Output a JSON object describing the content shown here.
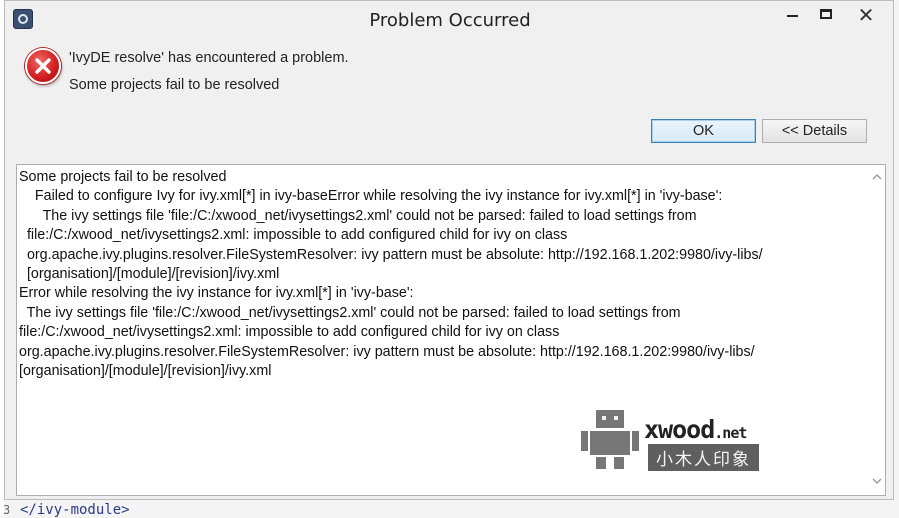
{
  "background": {
    "line_number": "3",
    "code_line": "</ivy-module>"
  },
  "window": {
    "title": "Problem Occurred",
    "minimize_label": "–",
    "maximize_label": "□",
    "close_label": "✕"
  },
  "message": {
    "line1": "'IvyDE resolve' has encountered a problem.",
    "line2": "Some projects fail to be resolved"
  },
  "buttons": {
    "ok": "OK",
    "details": "<< Details"
  },
  "details": {
    "lines": [
      "Some projects fail to be resolved",
      "    Failed to configure Ivy for ivy.xml[*] in ivy-baseError while resolving the ivy instance for ivy.xml[*] in 'ivy-base':",
      "      The ivy settings file 'file:/C:/xwood_net/ivysettings2.xml' could not be parsed: failed to load settings from",
      "  file:/C:/xwood_net/ivysettings2.xml: impossible to add configured child for ivy on class",
      "  org.apache.ivy.plugins.resolver.FileSystemResolver: ivy pattern must be absolute: http://192.168.1.202:9980/ivy-libs/",
      "  [organisation]/[module]/[revision]/ivy.xml",
      "Error while resolving the ivy instance for ivy.xml[*] in 'ivy-base':",
      "  The ivy settings file 'file:/C:/xwood_net/ivysettings2.xml' could not be parsed: failed to load settings from",
      "file:/C:/xwood_net/ivysettings2.xml: impossible to add configured child for ivy on class",
      "org.apache.ivy.plugins.resolver.FileSystemResolver: ivy pattern must be absolute: http://192.168.1.202:9980/ivy-libs/",
      "[organisation]/[module]/[revision]/ivy.xml"
    ]
  },
  "watermark": {
    "brand": "xwood",
    "tld": ".net",
    "chinese": "小木人印象"
  },
  "icons": {
    "app": "eclipse-app-icon",
    "error": "error-icon",
    "scroll_up": "chevron-up-icon",
    "scroll_down": "chevron-down-icon",
    "watermark": "robot-icon"
  }
}
